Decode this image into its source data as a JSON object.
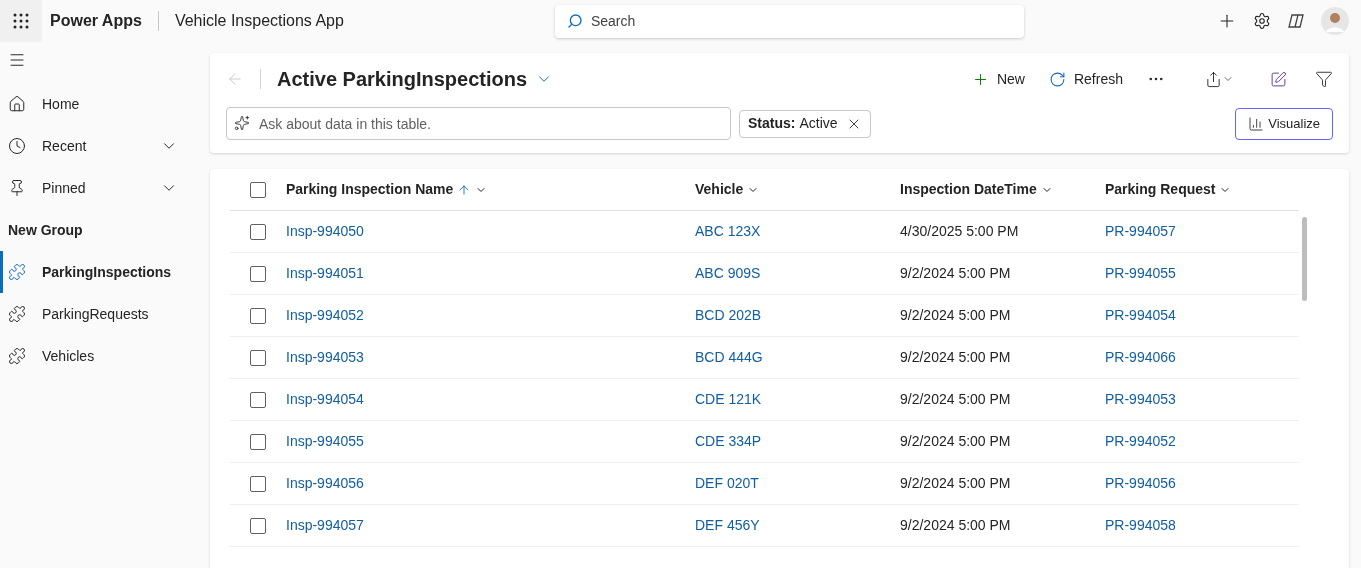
{
  "app": {
    "name": "Power Apps",
    "title": "Vehicle Inspections App"
  },
  "search": {
    "placeholder": "Search"
  },
  "sidebar": {
    "items": [
      {
        "label": "Home",
        "expandable": false
      },
      {
        "label": "Recent",
        "expandable": true
      },
      {
        "label": "Pinned",
        "expandable": true
      }
    ],
    "group": {
      "label": "New Group",
      "items": [
        {
          "label": "ParkingInspections",
          "selected": true
        },
        {
          "label": "ParkingRequests",
          "selected": false
        },
        {
          "label": "Vehicles",
          "selected": false
        }
      ]
    }
  },
  "view": {
    "title": "Active ParkingInspections",
    "commands": [
      {
        "label": "New"
      },
      {
        "label": "Refresh"
      }
    ],
    "ask": {
      "placeholder": "Ask about data in this table."
    },
    "filter": {
      "label": "Status:",
      "value": "Active"
    },
    "visualize": "Visualize"
  },
  "table": {
    "all_checked": false,
    "columns": [
      {
        "label": "Parking Inspection Name",
        "sorted": true
      },
      {
        "label": "Vehicle",
        "sorted": false
      },
      {
        "label": "Inspection DateTime",
        "sorted": false
      },
      {
        "label": "Parking Request",
        "sorted": false
      }
    ],
    "rows": [
      {
        "checked": false,
        "cells": [
          "Insp-994050",
          "ABC 123X",
          "4/30/2025 5:00 PM",
          "PR-994057"
        ]
      },
      {
        "checked": false,
        "cells": [
          "Insp-994051",
          "ABC 909S",
          "9/2/2024 5:00 PM",
          "PR-994055"
        ]
      },
      {
        "checked": false,
        "cells": [
          "Insp-994052",
          "BCD 202B",
          "9/2/2024 5:00 PM",
          "PR-994054"
        ]
      },
      {
        "checked": false,
        "cells": [
          "Insp-994053",
          "BCD 444G",
          "9/2/2024 5:00 PM",
          "PR-994066"
        ]
      },
      {
        "checked": false,
        "cells": [
          "Insp-994054",
          "CDE 121K",
          "9/2/2024 5:00 PM",
          "PR-994053"
        ]
      },
      {
        "checked": false,
        "cells": [
          "Insp-994055",
          "CDE 334P",
          "9/2/2024 5:00 PM",
          "PR-994052"
        ]
      },
      {
        "checked": false,
        "cells": [
          "Insp-994056",
          "DEF 020T",
          "9/2/2024 5:00 PM",
          "PR-994056"
        ]
      },
      {
        "checked": false,
        "cells": [
          "Insp-994057",
          "DEF 456Y",
          "9/2/2024 5:00 PM",
          "PR-994058"
        ]
      }
    ]
  }
}
